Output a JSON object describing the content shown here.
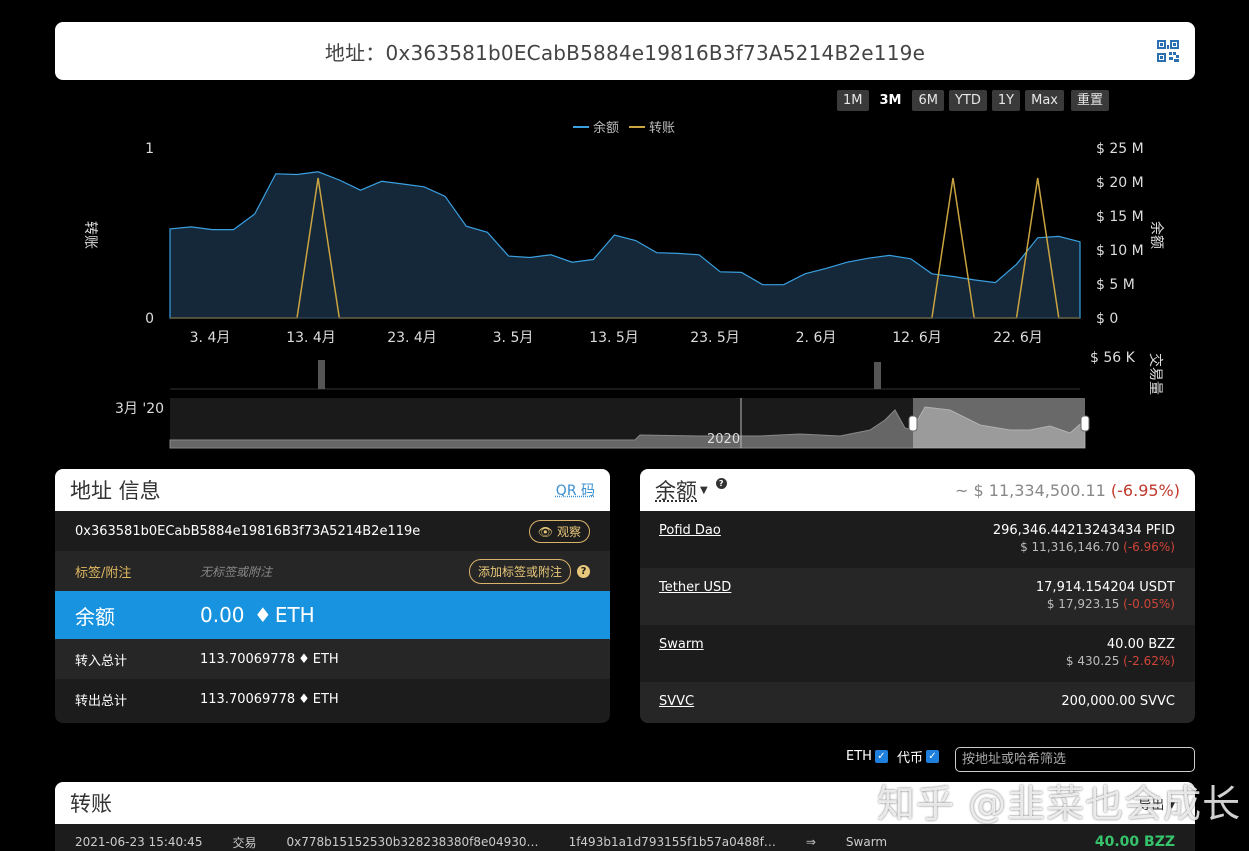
{
  "header": {
    "address_title": "地址：0x363581b0ECabB5884e19816B3f73A5214B2e119e"
  },
  "range_buttons": [
    "1M",
    "3M",
    "6M",
    "YTD",
    "1Y",
    "Max"
  ],
  "range_active": "3M",
  "reset_label": "重置",
  "legend": [
    {
      "name": "余额",
      "color": "#3aa0e0"
    },
    {
      "name": "转账",
      "color": "#c9a440"
    }
  ],
  "chart_data": {
    "type": "area",
    "x": [
      "3.4月",
      "13.4月",
      "23.4月",
      "3.5月",
      "13.5月",
      "23.5月",
      "2.6月",
      "12.6月",
      "22.6月"
    ],
    "x_tick_labels": [
      "3. 4月",
      "13. 4月",
      "23. 4月",
      "3. 5月",
      "13. 5月",
      "23. 5月",
      "2. 6月",
      "12. 6月",
      "22. 6月"
    ],
    "ylabel_left": "转账",
    "ylabel_right": "余额",
    "y_left_ticks": [
      "1",
      "0"
    ],
    "y_right_ticks": [
      "$ 25 M",
      "$ 20 M",
      "$ 15 M",
      "$ 10 M",
      "$ 5 M",
      "$ 0"
    ],
    "ylim_right": [
      0,
      25
    ],
    "series": [
      {
        "name": "余额",
        "values": [
          13.1,
          13.4,
          13.0,
          13.0,
          15.3,
          21.2,
          21.1,
          21.5,
          20.3,
          18.8,
          20.1,
          19.7,
          19.3,
          17.9,
          13.5,
          12.6,
          9.1,
          8.9,
          9.3,
          8.2,
          8.6,
          12.2,
          11.4,
          9.6,
          9.5,
          9.3,
          6.8,
          6.7,
          4.9,
          4.9,
          6.5,
          7.3,
          8.2,
          8.8,
          9.2,
          8.7,
          6.5,
          6.1,
          5.6,
          5.2,
          7.9,
          11.8,
          12.0,
          11.2
        ]
      },
      {
        "name": "转账",
        "values": [
          0,
          0,
          0,
          0,
          0,
          0,
          0,
          1,
          0,
          0,
          0,
          0,
          0,
          0,
          0,
          0,
          0,
          0,
          0,
          0,
          0,
          0,
          0,
          0,
          0,
          0,
          0,
          0,
          0,
          0,
          0,
          0,
          0,
          0,
          0,
          0,
          0,
          1,
          0,
          0,
          0,
          1,
          0,
          0
        ]
      }
    ],
    "volume_label": "交易量",
    "volume_tick": "$ 56 K",
    "navigator_start_label": "3月 '20",
    "navigator_year_label": "2020"
  },
  "info_panel": {
    "title": "地址 信息",
    "qr_link": "QR 码",
    "address": "0x363581b0ECabB5884e19816B3f73A5214B2e119e",
    "watch_label": "观察",
    "tag_label": "标签/附注",
    "tag_placeholder": "无标签或附注",
    "add_tag_label": "添加标签或附注",
    "balance_label": "余额",
    "balance_value": "0.00",
    "balance_unit": "ETH",
    "received_label": "转入总计",
    "received_value": "113.70069778",
    "received_unit": "ETH",
    "sent_label": "转出总计",
    "sent_value": "113.70069778",
    "sent_unit": "ETH"
  },
  "balance_panel": {
    "title": "余额",
    "total_prefix": "~ $ 11,334,500.11",
    "total_change": "(-6.95%)",
    "tokens": [
      {
        "name": "Pofid Dao",
        "amount": "296,346.44213243434 PFID",
        "usd": "$ 11,316,146.70",
        "change": "(-6.96%)"
      },
      {
        "name": "Tether USD",
        "amount": "17,914.154204 USDT",
        "usd": "$ 17,923.15",
        "change": "(-0.05%)"
      },
      {
        "name": "Swarm",
        "amount": "40.00 BZZ",
        "usd": "$ 430.25",
        "change": "(-2.62%)"
      },
      {
        "name": "SVVC",
        "amount": "200,000.00 SVVC",
        "usd": "",
        "change": ""
      }
    ]
  },
  "filter": {
    "eth_label": "ETH",
    "token_label": "代币",
    "placeholder": "按地址或哈希筛选"
  },
  "transfers": {
    "title": "转账",
    "export_label": "导出 ▾",
    "first_row": {
      "time": "2021-06-23 15:40:45",
      "type": "交易",
      "hash": "0x778b15152530b328238380f8e04930…",
      "counterparty": "1f493b1a1d793155f1b57a0488f…",
      "arrow": "⇒",
      "token": "Swarm",
      "amount": "40.00 BZZ"
    }
  },
  "watermark": "知乎 @韭菜也会成长"
}
